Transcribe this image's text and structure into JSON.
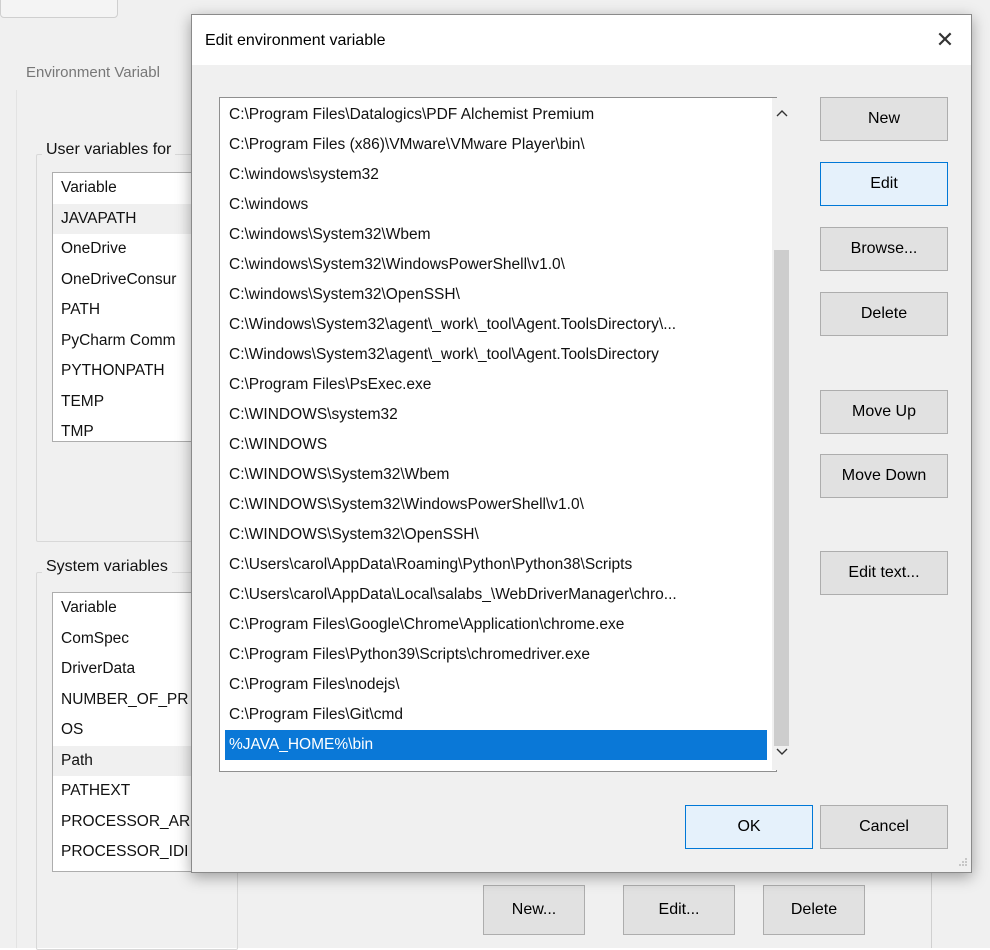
{
  "background": {
    "window_title": "Environment Variabl",
    "user_group_title": "User variables for",
    "user_variables": [
      "Variable",
      "JAVAPATH",
      "OneDrive",
      "OneDriveConsur",
      "PATH",
      "PyCharm Comm",
      "PYTHONPATH",
      "TEMP",
      "TMP"
    ],
    "system_group_title": "System variables",
    "system_variables": [
      "Variable",
      "ComSpec",
      "DriverData",
      "NUMBER_OF_PR",
      "OS",
      "Path",
      "PATHEXT",
      "PROCESSOR_AR",
      "PROCESSOR_IDI"
    ],
    "buttons": {
      "new": "New...",
      "edit": "Edit...",
      "delete": "Delete"
    }
  },
  "dialog": {
    "title": "Edit environment variable",
    "close_glyph": "✕",
    "paths": [
      "C:\\Program Files\\Datalogics\\PDF Alchemist Premium",
      "C:\\Program Files (x86)\\VMware\\VMware Player\\bin\\",
      "C:\\windows\\system32",
      "C:\\windows",
      "C:\\windows\\System32\\Wbem",
      "C:\\windows\\System32\\WindowsPowerShell\\v1.0\\",
      "C:\\windows\\System32\\OpenSSH\\",
      "C:\\Windows\\System32\\agent\\_work\\_tool\\Agent.ToolsDirectory\\...",
      "C:\\Windows\\System32\\agent\\_work\\_tool\\Agent.ToolsDirectory",
      "C:\\Program Files\\PsExec.exe",
      "C:\\WINDOWS\\system32",
      "C:\\WINDOWS",
      "C:\\WINDOWS\\System32\\Wbem",
      "C:\\WINDOWS\\System32\\WindowsPowerShell\\v1.0\\",
      "C:\\WINDOWS\\System32\\OpenSSH\\",
      "C:\\Users\\carol\\AppData\\Roaming\\Python\\Python38\\Scripts",
      "C:\\Users\\carol\\AppData\\Local\\salabs_\\WebDriverManager\\chro...",
      "C:\\Program Files\\Google\\Chrome\\Application\\chrome.exe",
      "C:\\Program Files\\Python39\\Scripts\\chromedriver.exe",
      "C:\\Program Files\\nodejs\\",
      "C:\\Program Files\\Git\\cmd",
      "%JAVA_HOME%\\bin"
    ],
    "selected_path": "%JAVA_HOME%\\bin",
    "buttons": {
      "new": "New",
      "edit": "Edit",
      "browse": "Browse...",
      "delete": "Delete",
      "move_up": "Move Up",
      "move_down": "Move Down",
      "edit_text": "Edit text...",
      "ok": "OK",
      "cancel": "Cancel"
    },
    "colors": {
      "selection": "#0a78d7",
      "focus_border": "#0078d7"
    }
  }
}
